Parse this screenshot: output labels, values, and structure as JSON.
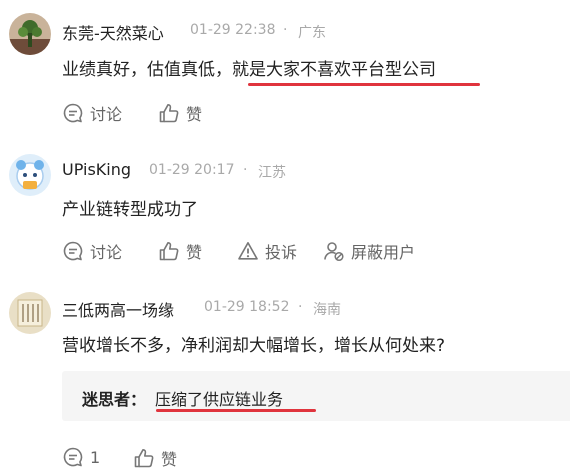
{
  "comments": [
    {
      "username": "东莞-天然菜心",
      "time": "01-29 22:38",
      "location": "广东",
      "text_plain": "业绩真好，估值真低，",
      "text_highlight": "就是大家不喜欢平台型公司",
      "actions": {
        "discuss": "讨论",
        "like": "赞"
      }
    },
    {
      "username": "UPisKing",
      "time": "01-29 20:17",
      "location": "江苏",
      "text": "产业链转型成功了",
      "actions": {
        "discuss": "讨论",
        "like": "赞",
        "report": "投诉",
        "block": "屏蔽用户"
      }
    },
    {
      "username": "三低两高一场缘",
      "time": "01-29 18:52",
      "location": "海南",
      "text": "营收增长不多，净利润却大幅增长，增长从何处来?",
      "reply": {
        "user": "迷思者",
        "separator": "：",
        "text": "压缩了供应链业务"
      },
      "actions": {
        "discuss_count": "1",
        "like": "赞"
      }
    }
  ],
  "meta_separator": "·",
  "colors": {
    "highlight_underline": "#e0343d",
    "meta": "#a9a9a9",
    "action": "#666666"
  },
  "icons": [
    "avatar-plant-icon",
    "avatar-cartoon-icon",
    "avatar-calligraphy-icon",
    "discuss-icon",
    "like-icon",
    "report-icon",
    "block-user-icon"
  ]
}
